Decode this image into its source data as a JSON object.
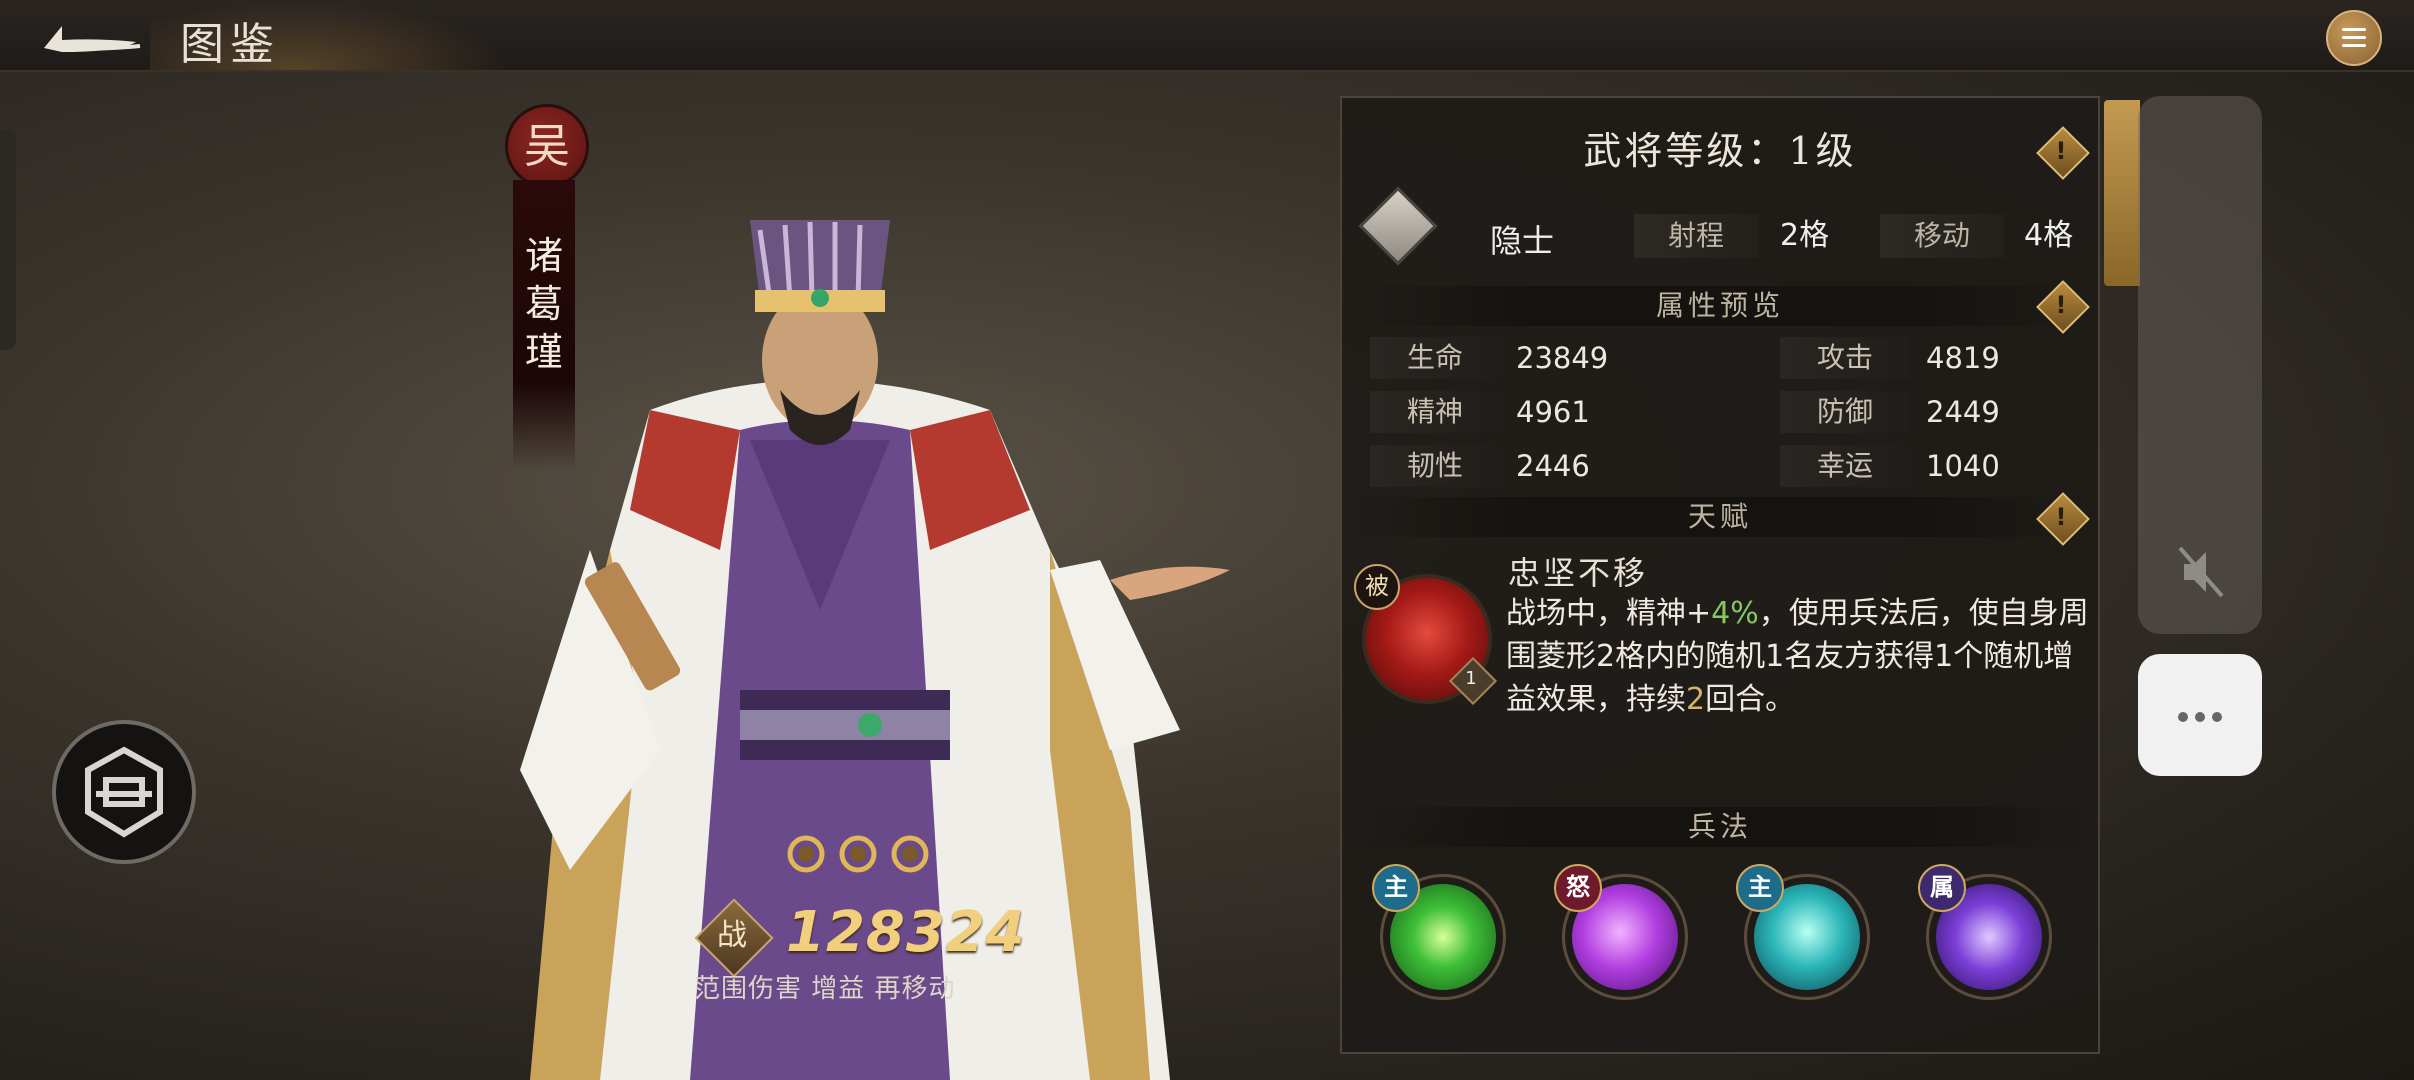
{
  "header": {
    "title": "图鉴"
  },
  "hero": {
    "faction": "吴",
    "name_chars": [
      "诸",
      "葛",
      "瑾"
    ],
    "power_icon_label": "战",
    "power": "128324",
    "tags": "范围伤害 增益 再移动",
    "stars": 3
  },
  "panel": {
    "level_title": "武将等级：1级",
    "class_name": "隐士",
    "range_label": "射程",
    "range_value": "2格",
    "move_label": "移动",
    "move_value": "4格",
    "attr_section": "属性预览",
    "attributes": [
      {
        "label": "生命",
        "value": "23849"
      },
      {
        "label": "攻击",
        "value": "4819"
      },
      {
        "label": "精神",
        "value": "4961"
      },
      {
        "label": "防御",
        "value": "2449"
      },
      {
        "label": "韧性",
        "value": "2446"
      },
      {
        "label": "幸运",
        "value": "1040"
      }
    ],
    "talent_section": "天赋",
    "talent": {
      "badge": "被",
      "level": "1",
      "name": "忠坚不移",
      "desc_1": "战场中，精神+",
      "desc_pct": "4%",
      "desc_2": "，使用兵法后，使自身周围菱形2格内的随机1名友方获得1个随机增益效果，持续",
      "desc_turns": "2",
      "desc_3": "回合。"
    },
    "arts_section": "兵法",
    "arts": [
      {
        "tag": "主",
        "icon": "green-whirlwind-icon"
      },
      {
        "tag": "怒",
        "icon": "purple-burst-icon"
      },
      {
        "tag": "主",
        "icon": "cyan-strike-icon"
      },
      {
        "tag": "属",
        "icon": "purple-scroll-icon"
      }
    ],
    "warn_glyph": "!"
  },
  "colors": {
    "accent_gold": "#d7b36a",
    "highlight_green": "#86c860",
    "faction_red": "#8c2623"
  }
}
